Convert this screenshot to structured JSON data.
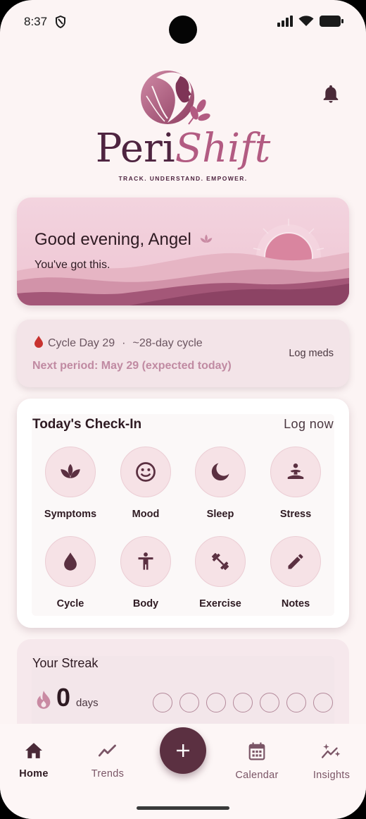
{
  "status_bar": {
    "time": "8:37"
  },
  "header": {
    "brand_part1": "Peri",
    "brand_part2": "Shift",
    "tagline": "TRACK. UNDERSTAND. EMPOWER."
  },
  "greeting": {
    "title": "Good evening, Angel",
    "subtitle": "You've got this."
  },
  "cycle": {
    "day_text": "Cycle Day 29",
    "separator": "·",
    "cycle_length": "~28-day cycle",
    "next_period": "Next period: May 29 (expected today)",
    "log_meds": "Log meds"
  },
  "checkin": {
    "title": "Today's Check-In",
    "log_now": "Log now",
    "items": [
      {
        "label": "Symptoms",
        "icon": "lotus-icon"
      },
      {
        "label": "Mood",
        "icon": "smiley-icon"
      },
      {
        "label": "Sleep",
        "icon": "moon-icon"
      },
      {
        "label": "Stress",
        "icon": "meditation-icon"
      },
      {
        "label": "Cycle",
        "icon": "drop-icon"
      },
      {
        "label": "Body",
        "icon": "body-icon"
      },
      {
        "label": "Exercise",
        "icon": "dumbbell-icon"
      },
      {
        "label": "Notes",
        "icon": "pencil-icon"
      }
    ]
  },
  "streak": {
    "title": "Your Streak",
    "count": "0",
    "unit": "days",
    "week_completed": 0,
    "week_total": 7
  },
  "nav": {
    "items": [
      {
        "label": "Home",
        "icon": "home-icon",
        "active": true
      },
      {
        "label": "Trends",
        "icon": "trend-icon",
        "active": false
      },
      {
        "label": "Calendar",
        "icon": "calendar-icon",
        "active": false
      },
      {
        "label": "Insights",
        "icon": "sparkle-chart-icon",
        "active": false
      }
    ],
    "fab": "add-icon"
  },
  "colors": {
    "primary": "#5b3041",
    "accent": "#b25b82",
    "background": "#fcf4f4",
    "card_tint": "#f6e2e6"
  }
}
